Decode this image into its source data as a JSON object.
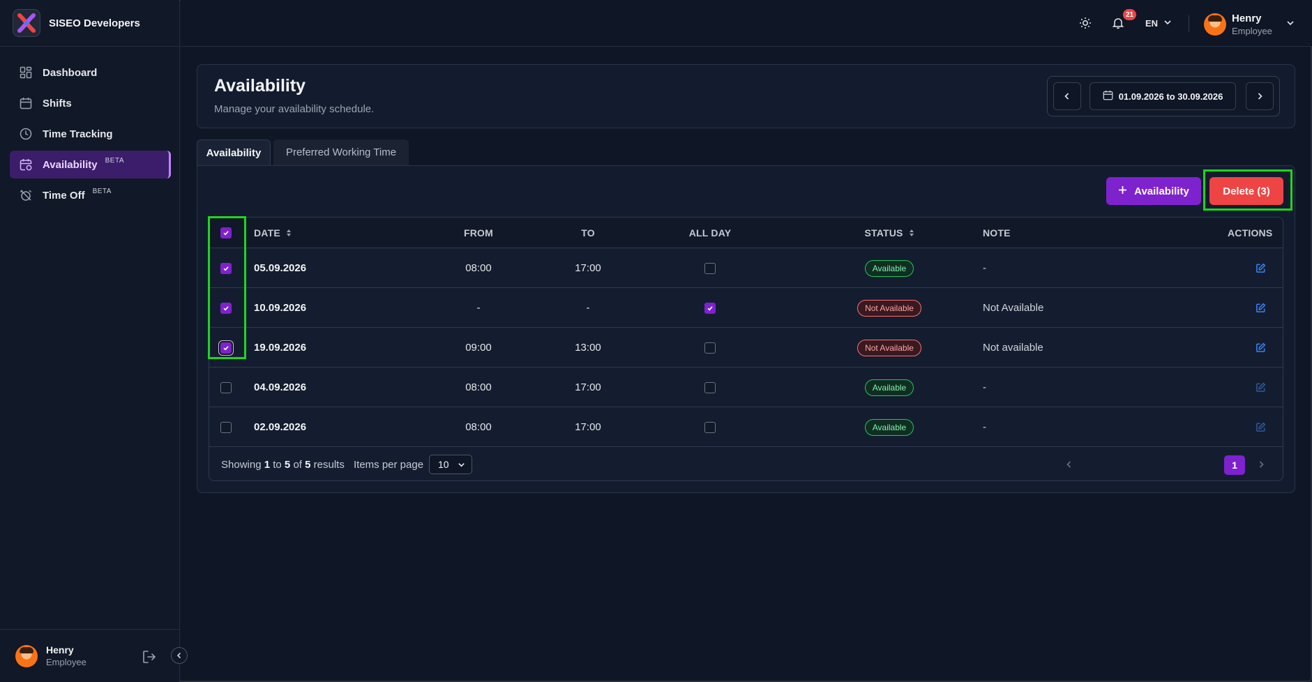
{
  "app": {
    "brand_name": "SISEO Developers",
    "logo_icon": "x-logo-icon",
    "accent": "#7e22ce"
  },
  "sidebar": {
    "items": [
      {
        "label": "Dashboard",
        "icon": "grid-icon",
        "beta": ""
      },
      {
        "label": "Shifts",
        "icon": "calendar-icon",
        "beta": ""
      },
      {
        "label": "Time Tracking",
        "icon": "clock-icon",
        "beta": ""
      },
      {
        "label": "Availability",
        "icon": "calendar-clock-icon",
        "beta": "BETA"
      },
      {
        "label": "Time Off",
        "icon": "alarm-off-icon",
        "beta": "BETA"
      }
    ],
    "active_index": 3,
    "footer_user": {
      "name": "Henry",
      "role": "Employee"
    }
  },
  "topbar": {
    "notification_count": "21",
    "language": "EN",
    "user": {
      "name": "Henry",
      "role": "Employee"
    }
  },
  "header": {
    "title": "Availability",
    "subtitle": "Manage your availability schedule.",
    "date_range": "01.09.2026 to 30.09.2026"
  },
  "tabs": [
    {
      "label": "Availability",
      "active": true
    },
    {
      "label": "Preferred Working Time",
      "active": false
    }
  ],
  "actions": {
    "add_label": "Availability",
    "delete_label": "Delete (3)"
  },
  "table": {
    "headers": {
      "date": "DATE",
      "from": "FROM",
      "to": "TO",
      "all_day": "ALL DAY",
      "status": "STATUS",
      "note": "NOTE",
      "actions": "ACTIONS"
    },
    "select_all_checked": true,
    "rows": [
      {
        "selected": true,
        "date": "05.09.2026",
        "from": "08:00",
        "to": "17:00",
        "all_day": false,
        "status": "Available",
        "note": "-"
      },
      {
        "selected": true,
        "date": "10.09.2026",
        "from": "-",
        "to": "-",
        "all_day": true,
        "status": "Not Available",
        "note": "Not Available"
      },
      {
        "selected": true,
        "date": "19.09.2026",
        "from": "09:00",
        "to": "13:00",
        "all_day": false,
        "status": "Not Available",
        "note": "Not available"
      },
      {
        "selected": false,
        "date": "04.09.2026",
        "from": "08:00",
        "to": "17:00",
        "all_day": false,
        "status": "Available",
        "note": "-"
      },
      {
        "selected": false,
        "date": "02.09.2026",
        "from": "08:00",
        "to": "17:00",
        "all_day": false,
        "status": "Available",
        "note": "-"
      }
    ]
  },
  "pagination": {
    "showing_prefix": "Showing",
    "from": "1",
    "to_word": "to",
    "to": "5",
    "of_word": "of",
    "total": "5",
    "results_word": "results",
    "items_per_page_label": "Items per page",
    "items_per_page": "10",
    "current_page": "1"
  }
}
